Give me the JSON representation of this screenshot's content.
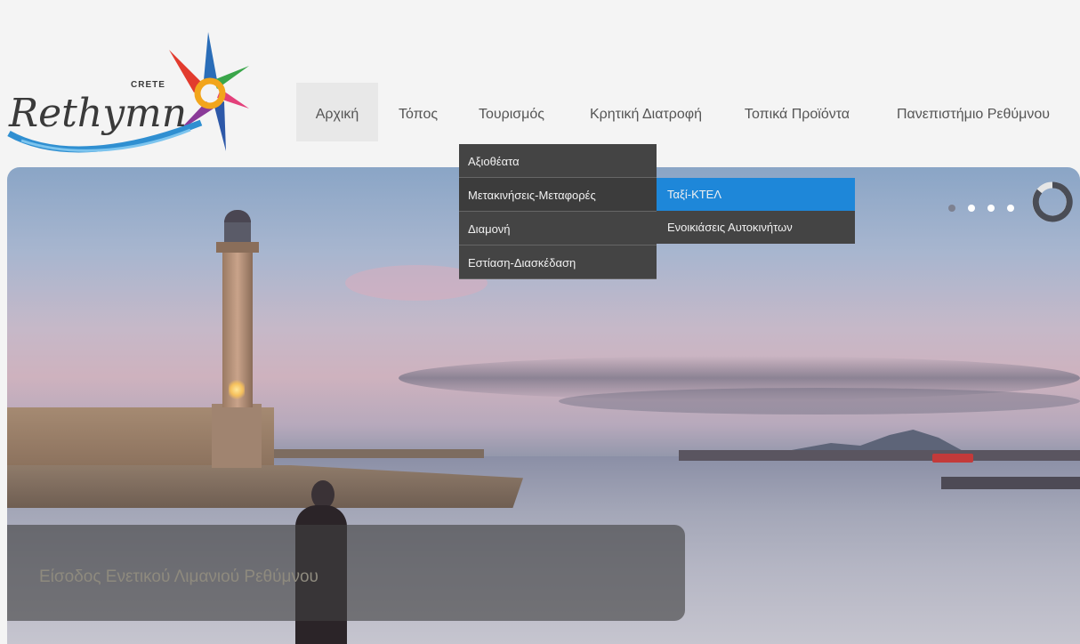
{
  "brand": {
    "logo_text": "Rethymn",
    "logo_sub": "CRETE"
  },
  "nav": {
    "items": [
      {
        "label": "Αρχική"
      },
      {
        "label": "Τόπος"
      },
      {
        "label": "Τουρισμός"
      },
      {
        "label": "Κρητική Διατροφή"
      },
      {
        "label": "Τοπικά Προϊόντα"
      },
      {
        "label": "Πανεπιστήμιο Ρεθύμνου"
      }
    ]
  },
  "dropdown": {
    "items": [
      {
        "label": "Αξιοθέατα"
      },
      {
        "label": "Μετακινήσεις-Μεταφορές"
      },
      {
        "label": "Διαμονή"
      },
      {
        "label": "Εστίαση-Διασκέδαση"
      }
    ]
  },
  "submenu": {
    "items": [
      {
        "label": "Ταξί-ΚΤΕΛ"
      },
      {
        "label": "Ενοικιάσεις Αυτοκινήτων"
      }
    ]
  },
  "slider": {
    "caption": "Είσοδος Ενετικού Λιμανιού Ρεθύμνου",
    "dots": 4,
    "active_dot": 1
  },
  "colors": {
    "accent": "#1e87d9",
    "menu_bg": "#444444"
  }
}
